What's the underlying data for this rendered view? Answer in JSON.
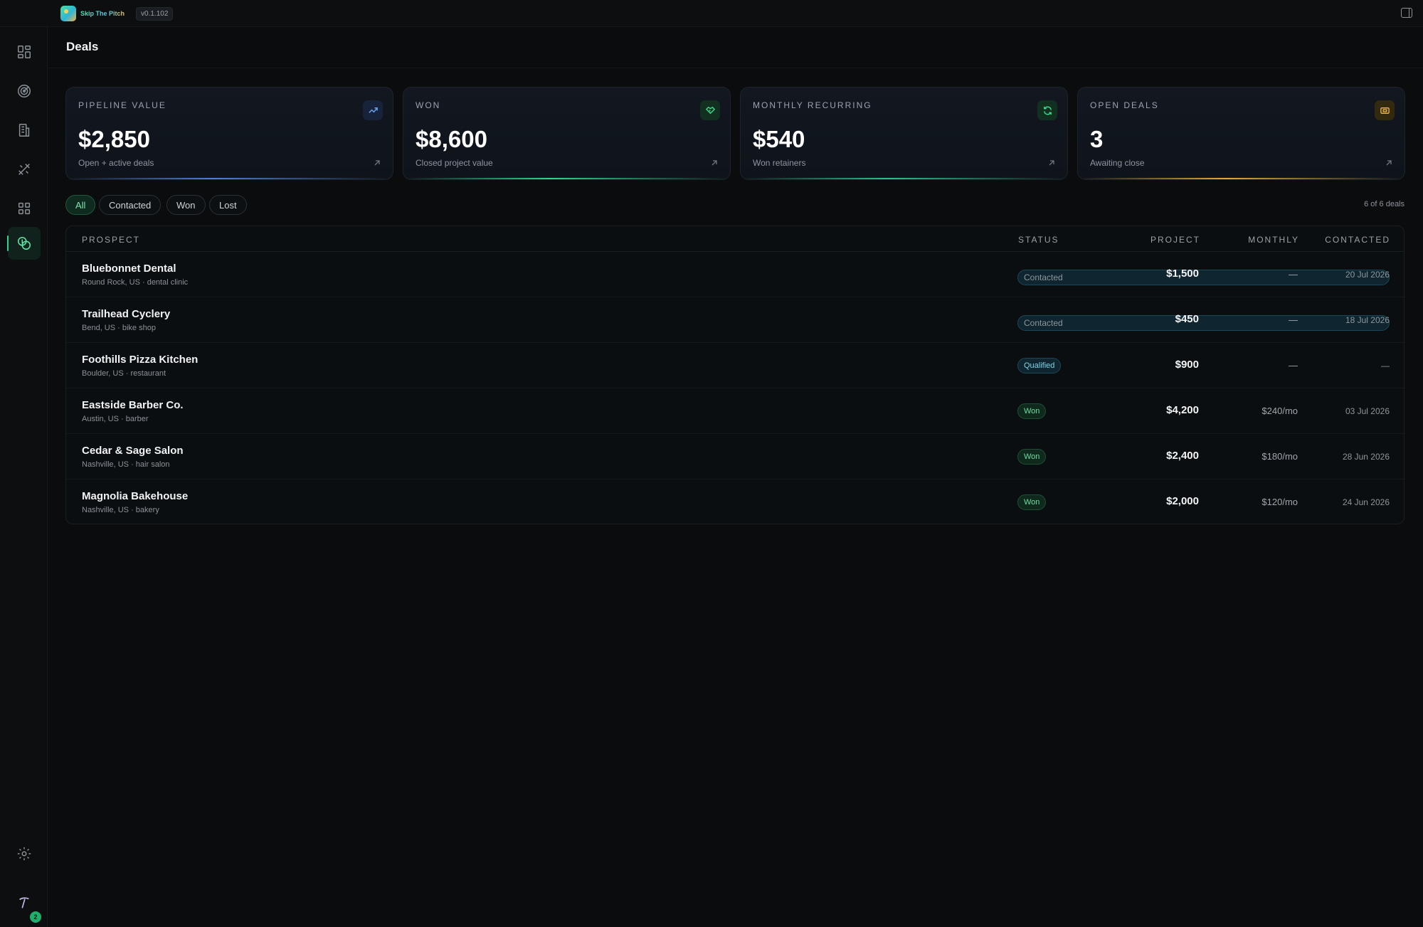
{
  "app": {
    "brand_name": "Skip The Pitch",
    "version": "v0.1.102"
  },
  "sidebar": {
    "items": [
      {
        "icon": "dashboard-icon"
      },
      {
        "icon": "target-icon"
      },
      {
        "icon": "building-icon"
      },
      {
        "icon": "tools-icon"
      },
      {
        "icon": "apps-grid-icon"
      },
      {
        "icon": "deals-coins-icon",
        "active": true
      }
    ],
    "settings_icon": "gear-icon",
    "user_badge_count": "2"
  },
  "page": {
    "title": "Deals"
  },
  "stats": [
    {
      "label": "PIPELINE VALUE",
      "value": "$2,850",
      "sub": "Open + active deals",
      "icon": "trend-up-icon",
      "accent": "#4d7fd6"
    },
    {
      "label": "WON",
      "value": "$8,600",
      "sub": "Closed project value",
      "icon": "handshake-icon",
      "accent": "#2fd58a"
    },
    {
      "label": "MONTHLY RECURRING",
      "value": "$540",
      "sub": "Won retainers",
      "icon": "refresh-icon",
      "accent": "#2fbf8a"
    },
    {
      "label": "OPEN DEALS",
      "value": "3",
      "sub": "Awaiting close",
      "icon": "ticket-icon",
      "accent": "#e0a83a"
    }
  ],
  "filters": {
    "options": [
      "All",
      "Contacted",
      "Won",
      "Lost"
    ],
    "selected": "All",
    "count_text": "6 of 6 deals"
  },
  "table": {
    "headers": {
      "prospect": "PROSPECT",
      "status": "STATUS",
      "project": "PROJECT",
      "monthly": "MONTHLY",
      "contacted": "CONTACTED"
    },
    "rows": [
      {
        "name": "Bluebonnet Dental",
        "meta": "Round Rock, US · dental clinic",
        "status": "Contacted",
        "status_kind": "contacted",
        "project": "$1,500",
        "monthly": "—",
        "contacted": "20 Jul 2026"
      },
      {
        "name": "Trailhead Cyclery",
        "meta": "Bend, US · bike shop",
        "status": "Contacted",
        "status_kind": "contacted",
        "project": "$450",
        "monthly": "—",
        "contacted": "18 Jul 2026"
      },
      {
        "name": "Foothills Pizza Kitchen",
        "meta": "Boulder, US · restaurant",
        "status": "Qualified",
        "status_kind": "qualified",
        "project": "$900",
        "monthly": "—",
        "contacted": "—"
      },
      {
        "name": "Eastside Barber Co.",
        "meta": "Austin, US · barber",
        "status": "Won",
        "status_kind": "won",
        "project": "$4,200",
        "monthly": "$240/mo",
        "contacted": "03 Jul 2026"
      },
      {
        "name": "Cedar & Sage Salon",
        "meta": "Nashville, US · hair salon",
        "status": "Won",
        "status_kind": "won",
        "project": "$2,400",
        "monthly": "$180/mo",
        "contacted": "28 Jun 2026"
      },
      {
        "name": "Magnolia Bakehouse",
        "meta": "Nashville, US · bakery",
        "status": "Won",
        "status_kind": "won",
        "project": "$2,000",
        "monthly": "$120/mo",
        "contacted": "24 Jun 2026"
      }
    ]
  }
}
